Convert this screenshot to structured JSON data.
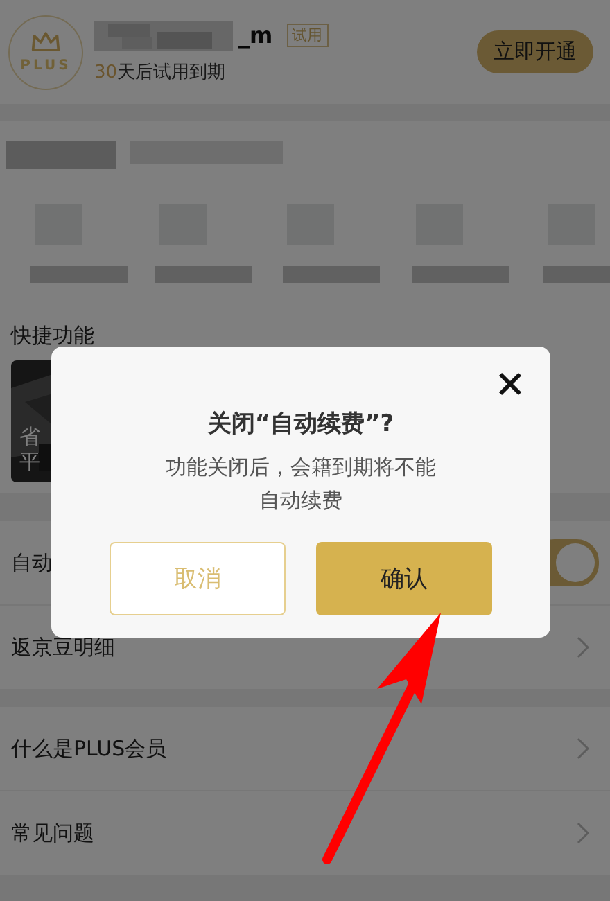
{
  "header": {
    "avatar_label": "PLUS",
    "username": "_m",
    "badge": "试用",
    "trial_days": "30",
    "trial_text": "天后试用到期",
    "action": "立即开通"
  },
  "quick_functions": {
    "title": "快捷功能",
    "card_lines": [
      "省",
      "平"
    ]
  },
  "rows": [
    {
      "kind": "toggle",
      "label": "自动",
      "on": true
    },
    {
      "kind": "link",
      "label": "返京豆明细"
    },
    {
      "kind": "link",
      "label": "什么是PLUS会员"
    },
    {
      "kind": "link",
      "label": "常见问题"
    }
  ],
  "dialog": {
    "title": "关闭“自动续费”?",
    "message": "功能关闭后，会籍到期将不能自动续费",
    "buttons": [
      {
        "label": "取消",
        "kind": "secondary"
      },
      {
        "label": "确认",
        "kind": "primary"
      }
    ]
  }
}
